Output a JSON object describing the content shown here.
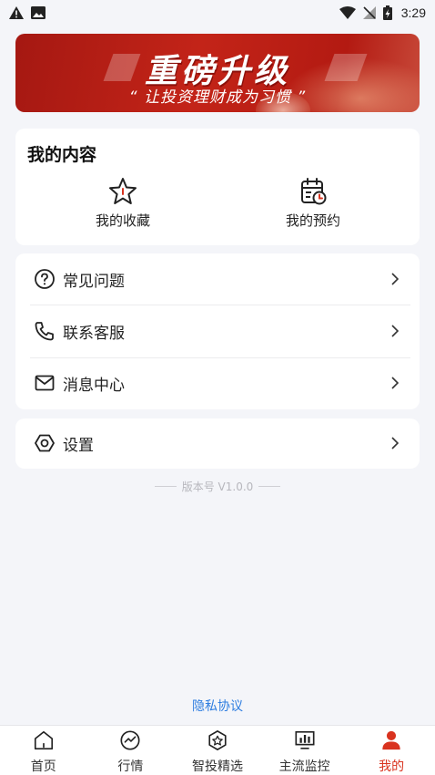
{
  "status_bar": {
    "time": "3:29"
  },
  "banner": {
    "title": "重磅升级",
    "subtitle": "“ 让投资理财成为习惯 ”"
  },
  "my_content": {
    "title": "我的内容",
    "items": [
      {
        "label": "我的收藏",
        "icon": "star-icon"
      },
      {
        "label": "我的预约",
        "icon": "calendar-clock-icon"
      }
    ]
  },
  "menu": [
    {
      "label": "常见问题",
      "icon": "question-circle-icon"
    },
    {
      "label": "联系客服",
      "icon": "phone-icon"
    },
    {
      "label": "消息中心",
      "icon": "mail-icon"
    }
  ],
  "settings": {
    "label": "设置",
    "icon": "gear-icon"
  },
  "version": "版本号 V1.0.0",
  "privacy": "隐私协议",
  "tabbar": [
    {
      "label": "首页",
      "icon": "home-icon"
    },
    {
      "label": "行情",
      "icon": "market-icon"
    },
    {
      "label": "智投精选",
      "icon": "smart-invest-icon"
    },
    {
      "label": "主流监控",
      "icon": "monitor-icon"
    },
    {
      "label": "我的",
      "icon": "user-icon",
      "active": true
    }
  ],
  "colors": {
    "accent": "#d9331f",
    "link": "#2f7ee0",
    "background": "#f4f5f9",
    "banner_red": "#c32418"
  }
}
